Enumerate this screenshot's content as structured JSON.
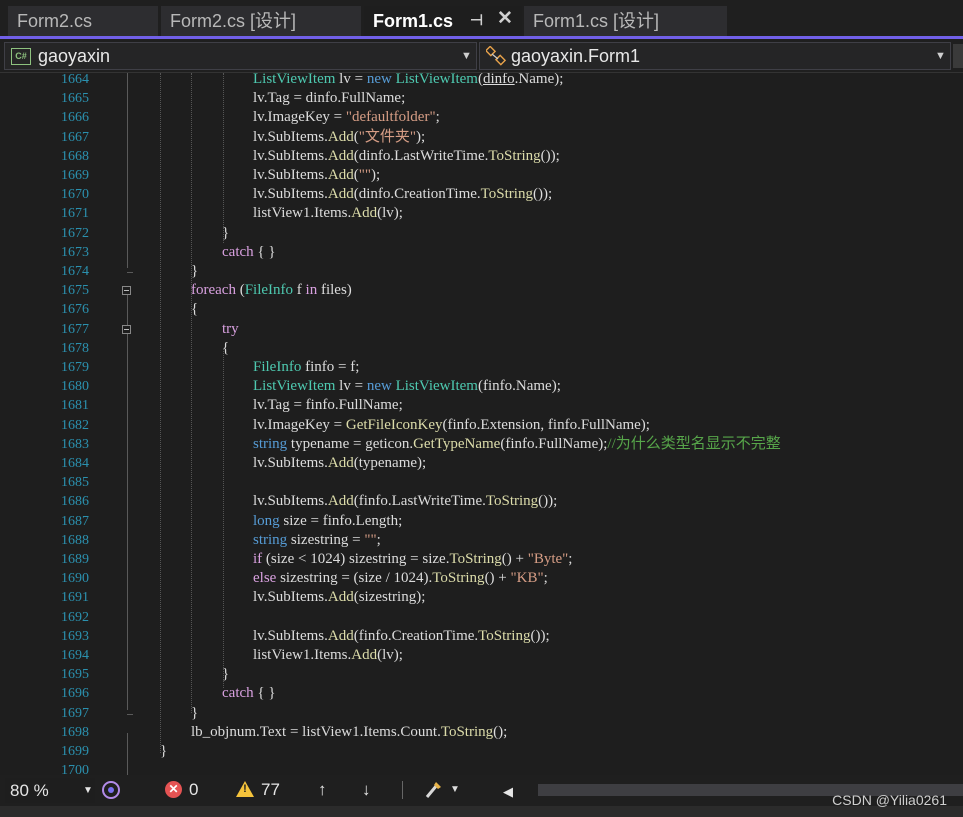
{
  "tabs": [
    {
      "label": "Form2.cs",
      "active": false
    },
    {
      "label": "Form2.cs [设计]",
      "active": false
    },
    {
      "label": "Form1.cs",
      "active": true
    },
    {
      "label": "Form1.cs [设计]",
      "active": false
    }
  ],
  "nav": {
    "project": "gaoyaxin",
    "project_badge": "C#",
    "class": "gaoyaxin.Form1"
  },
  "gutter": {
    "line_numbers": [
      "1664",
      "1665",
      "1666",
      "1667",
      "1668",
      "1669",
      "1670",
      "1671",
      "1672",
      "1673",
      "1674",
      "1675",
      "1676",
      "1677",
      "1678",
      "1679",
      "1680",
      "1681",
      "1682",
      "1683",
      "1684",
      "1685",
      "1686",
      "1687",
      "1688",
      "1689",
      "1690",
      "1691",
      "1692",
      "1693",
      "1694",
      "1695",
      "1696",
      "1697",
      "1698",
      "1699",
      "1700"
    ]
  },
  "code_lines": [
    {
      "indent": 3,
      "tokens": [
        [
          "ty",
          "ListViewItem"
        ],
        [
          "pl",
          " lv = "
        ],
        [
          "kw",
          "new"
        ],
        [
          "pl",
          " "
        ],
        [
          "ty",
          "ListViewItem"
        ],
        [
          "pl",
          "("
        ],
        [
          "ulpl",
          "dinfo"
        ],
        [
          "pl",
          ".Name);"
        ]
      ]
    },
    {
      "indent": 3,
      "tokens": [
        [
          "pl",
          "lv.Tag = dinfo.FullName;"
        ]
      ]
    },
    {
      "indent": 3,
      "tokens": [
        [
          "pl",
          "lv.ImageKey = "
        ],
        [
          "st",
          "\"defaultfolder\""
        ],
        [
          "pl",
          ";"
        ]
      ]
    },
    {
      "indent": 3,
      "tokens": [
        [
          "pl",
          "lv.SubItems."
        ],
        [
          "me",
          "Add"
        ],
        [
          "pl",
          "("
        ],
        [
          "st",
          "\"文件夹\""
        ],
        [
          "pl",
          ");"
        ]
      ]
    },
    {
      "indent": 3,
      "tokens": [
        [
          "pl",
          "lv.SubItems."
        ],
        [
          "me",
          "Add"
        ],
        [
          "pl",
          "(dinfo.LastWriteTime."
        ],
        [
          "me",
          "ToString"
        ],
        [
          "pl",
          "());"
        ]
      ]
    },
    {
      "indent": 3,
      "tokens": [
        [
          "pl",
          "lv.SubItems."
        ],
        [
          "me",
          "Add"
        ],
        [
          "pl",
          "("
        ],
        [
          "st",
          "\"\""
        ],
        [
          "pl",
          ");"
        ]
      ]
    },
    {
      "indent": 3,
      "tokens": [
        [
          "pl",
          "lv.SubItems."
        ],
        [
          "me",
          "Add"
        ],
        [
          "pl",
          "(dinfo.CreationTime."
        ],
        [
          "me",
          "ToString"
        ],
        [
          "pl",
          "());"
        ]
      ]
    },
    {
      "indent": 3,
      "tokens": [
        [
          "pl",
          "listView1.Items."
        ],
        [
          "me",
          "Add"
        ],
        [
          "pl",
          "(lv);"
        ]
      ]
    },
    {
      "indent": 2,
      "tokens": [
        [
          "pl",
          "}"
        ]
      ]
    },
    {
      "indent": 2,
      "tokens": [
        [
          "cf",
          "catch"
        ],
        [
          "pl",
          " { }"
        ]
      ]
    },
    {
      "indent": 1,
      "tokens": [
        [
          "pl",
          "}"
        ]
      ]
    },
    {
      "indent": 1,
      "tokens": [
        [
          "cf",
          "foreach"
        ],
        [
          "pl",
          " ("
        ],
        [
          "ty",
          "FileInfo"
        ],
        [
          "pl",
          " f "
        ],
        [
          "cf",
          "in"
        ],
        [
          "pl",
          " files)"
        ]
      ]
    },
    {
      "indent": 1,
      "tokens": [
        [
          "pl",
          "{"
        ]
      ]
    },
    {
      "indent": 2,
      "tokens": [
        [
          "cf",
          "try"
        ]
      ]
    },
    {
      "indent": 2,
      "tokens": [
        [
          "pl",
          "{"
        ]
      ]
    },
    {
      "indent": 3,
      "tokens": [
        [
          "ty",
          "FileInfo"
        ],
        [
          "pl",
          " finfo = f;"
        ]
      ]
    },
    {
      "indent": 3,
      "tokens": [
        [
          "ty",
          "ListViewItem"
        ],
        [
          "pl",
          " lv = "
        ],
        [
          "kw",
          "new"
        ],
        [
          "pl",
          " "
        ],
        [
          "ty",
          "ListViewItem"
        ],
        [
          "pl",
          "(finfo.Name);"
        ]
      ]
    },
    {
      "indent": 3,
      "tokens": [
        [
          "pl",
          "lv.Tag = finfo.FullName;"
        ]
      ]
    },
    {
      "indent": 3,
      "tokens": [
        [
          "pl",
          "lv.ImageKey = "
        ],
        [
          "me",
          "GetFileIconKey"
        ],
        [
          "pl",
          "(finfo.Extension, finfo.FullName);"
        ]
      ]
    },
    {
      "indent": 3,
      "tokens": [
        [
          "kw",
          "string"
        ],
        [
          "pl",
          " typename = geticon."
        ],
        [
          "me",
          "GetTypeName"
        ],
        [
          "pl",
          "(finfo.FullName);"
        ],
        [
          "co",
          "//为什么类型名显示不完整"
        ]
      ]
    },
    {
      "indent": 3,
      "tokens": [
        [
          "pl",
          "lv.SubItems."
        ],
        [
          "me",
          "Add"
        ],
        [
          "pl",
          "(typename);"
        ]
      ]
    },
    {
      "indent": 3,
      "tokens": []
    },
    {
      "indent": 3,
      "tokens": [
        [
          "pl",
          "lv.SubItems."
        ],
        [
          "me",
          "Add"
        ],
        [
          "pl",
          "(finfo.LastWriteTime."
        ],
        [
          "me",
          "ToString"
        ],
        [
          "pl",
          "());"
        ]
      ]
    },
    {
      "indent": 3,
      "tokens": [
        [
          "kw",
          "long"
        ],
        [
          "pl",
          " size = finfo.Length;"
        ]
      ]
    },
    {
      "indent": 3,
      "tokens": [
        [
          "kw",
          "string"
        ],
        [
          "pl",
          " sizestring = "
        ],
        [
          "st",
          "\"\""
        ],
        [
          "pl",
          ";"
        ]
      ]
    },
    {
      "indent": 3,
      "tokens": [
        [
          "cf",
          "if"
        ],
        [
          "pl",
          " (size < 1024) sizestring = size."
        ],
        [
          "me",
          "ToString"
        ],
        [
          "pl",
          "() + "
        ],
        [
          "st",
          "\"Byte\""
        ],
        [
          "pl",
          ";"
        ]
      ]
    },
    {
      "indent": 3,
      "tokens": [
        [
          "cf",
          "else"
        ],
        [
          "pl",
          " sizestring = (size / 1024)."
        ],
        [
          "me",
          "ToString"
        ],
        [
          "pl",
          "() + "
        ],
        [
          "st",
          "\"KB\""
        ],
        [
          "pl",
          ";"
        ]
      ]
    },
    {
      "indent": 3,
      "tokens": [
        [
          "pl",
          "lv.SubItems."
        ],
        [
          "me",
          "Add"
        ],
        [
          "pl",
          "(sizestring);"
        ]
      ]
    },
    {
      "indent": 3,
      "tokens": []
    },
    {
      "indent": 3,
      "tokens": [
        [
          "pl",
          "lv.SubItems."
        ],
        [
          "me",
          "Add"
        ],
        [
          "pl",
          "(finfo.CreationTime."
        ],
        [
          "me",
          "ToString"
        ],
        [
          "pl",
          "());"
        ]
      ]
    },
    {
      "indent": 3,
      "tokens": [
        [
          "pl",
          "listView1.Items."
        ],
        [
          "me",
          "Add"
        ],
        [
          "pl",
          "(lv);"
        ]
      ]
    },
    {
      "indent": 2,
      "tokens": [
        [
          "pl",
          "}"
        ]
      ]
    },
    {
      "indent": 2,
      "tokens": [
        [
          "cf",
          "catch"
        ],
        [
          "pl",
          " { }"
        ]
      ]
    },
    {
      "indent": 1,
      "tokens": [
        [
          "pl",
          "}"
        ]
      ]
    },
    {
      "indent": 1,
      "tokens": [
        [
          "pl",
          "lb_objnum.Text = listView1.Items.Count."
        ],
        [
          "me",
          "ToString"
        ],
        [
          "pl",
          "();"
        ]
      ]
    },
    {
      "indent": 0,
      "tokens": [
        [
          "pl",
          "}"
        ]
      ]
    },
    {
      "indent": 0,
      "tokens": []
    }
  ],
  "status": {
    "zoom": "80 %",
    "errors": "0",
    "warnings": "77",
    "error_icon": "x-circle-icon",
    "warning_icon": "warning-triangle-icon"
  },
  "watermark": "CSDN @Yilia0261",
  "colors": {
    "accent": "#7160e8",
    "line_number": "#2b91af",
    "keyword": "#569cd6",
    "type": "#4ec9b0",
    "string": "#d69d85",
    "method": "#dcdcaa",
    "comment": "#57a64a",
    "control_flow": "#d8a0df"
  }
}
